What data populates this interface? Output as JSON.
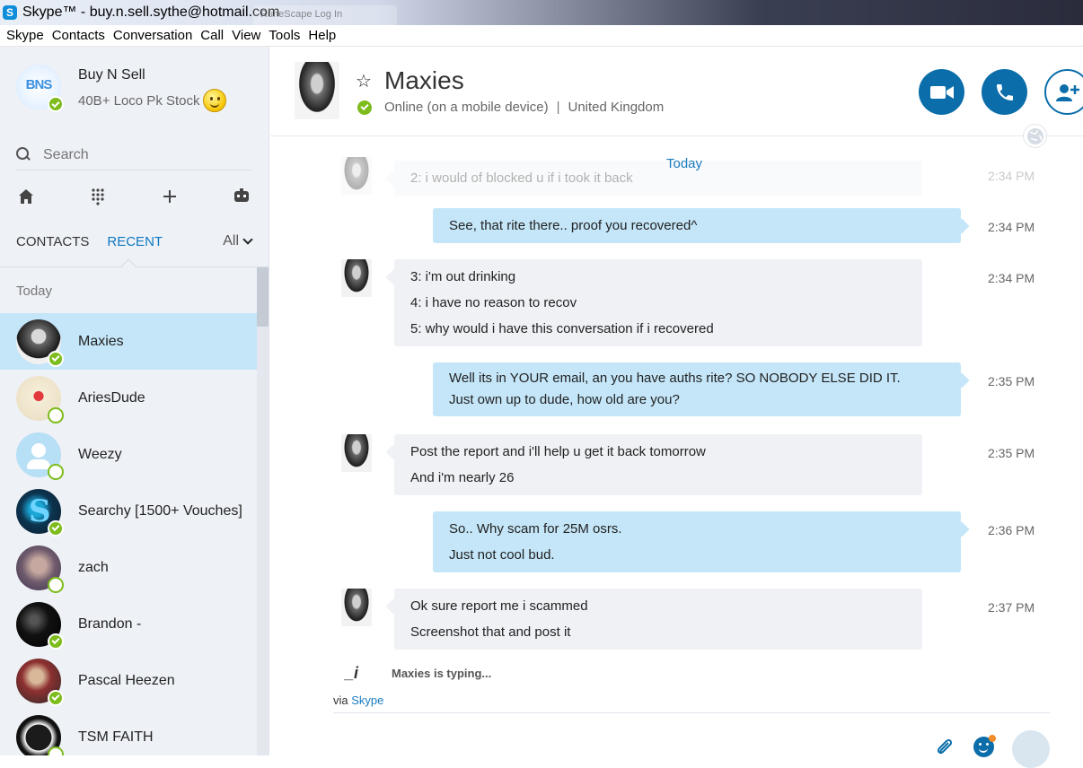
{
  "window": {
    "app_icon_letter": "S",
    "title": "Skype™ - buy.n.sell.sythe@hotmail.com",
    "background_tab": "RuneScape Log In"
  },
  "menu": [
    "Skype",
    "Contacts",
    "Conversation",
    "Call",
    "View",
    "Tools",
    "Help"
  ],
  "profile": {
    "avatar_text": "BNS",
    "name": "Buy N Sell",
    "mood": "40B+ Loco Pk Stock"
  },
  "search": {
    "placeholder": "Search"
  },
  "tabs": {
    "contacts": "CONTACTS",
    "recent": "RECENT",
    "filter": "All"
  },
  "list": {
    "section": "Today",
    "contacts": [
      {
        "name": "Maxies"
      },
      {
        "name": "AriesDude"
      },
      {
        "name": "Weezy"
      },
      {
        "name": "Searchy [1500+ Vouches]"
      },
      {
        "name": "zach"
      },
      {
        "name": "Brandon -"
      },
      {
        "name": "Pascal Heezen"
      },
      {
        "name": "TSM FAITH"
      }
    ]
  },
  "conversation": {
    "contact_name": "Maxies",
    "status": "Online (on a mobile device)",
    "separator": "|",
    "location": "United Kingdom",
    "day_label": "Today",
    "messages": [
      {
        "dir": "in",
        "lines": [
          "2: i would of blocked u if i took it back"
        ],
        "time": "2:34 PM"
      },
      {
        "dir": "out",
        "lines": [
          "See, that rite there.. proof you recovered^"
        ],
        "time": "2:34 PM"
      },
      {
        "dir": "in",
        "lines": [
          "3: i'm out drinking",
          "4: i have no reason to recov",
          "5: why would i have this conversation if i recovered"
        ],
        "time": "2:34 PM"
      },
      {
        "dir": "out",
        "lines": [
          "Well its in YOUR email, an you have auths rite? SO NOBODY ELSE DID IT.",
          "Just own up to dude, how old are you?"
        ],
        "time": "2:35 PM"
      },
      {
        "dir": "in",
        "lines": [
          "Post the report and i'll help u get it back tomorrow",
          "And i'm nearly 26"
        ],
        "time": "2:35 PM"
      },
      {
        "dir": "out",
        "lines": [
          "So.. Why scam for 25M osrs.",
          "Just not cool bud."
        ],
        "time": "2:36 PM"
      },
      {
        "dir": "in",
        "lines": [
          "Ok sure report me i scammed",
          "Screenshot that and post it"
        ],
        "time": "2:37 PM"
      }
    ],
    "typing_icon": "_i",
    "typing": "Maxies is typing...",
    "via_prefix": "via",
    "via_link": "Skype"
  },
  "colors": {
    "accent": "#0b6eaa",
    "selected_row": "#c4e6f8",
    "incoming_bubble": "#eff1f5",
    "outgoing_bubble": "#c4e6f8",
    "online": "#7dbc1c"
  },
  "icons": {
    "home": "home-icon",
    "dialpad": "dialpad-icon",
    "add": "plus-icon",
    "bots": "bot-icon",
    "video": "video-icon",
    "call": "phone-icon",
    "add_people": "add-person-icon",
    "globe": "globe-icon",
    "attach": "paperclip-icon",
    "emoji": "emoticon-icon",
    "send": "send-icon"
  }
}
